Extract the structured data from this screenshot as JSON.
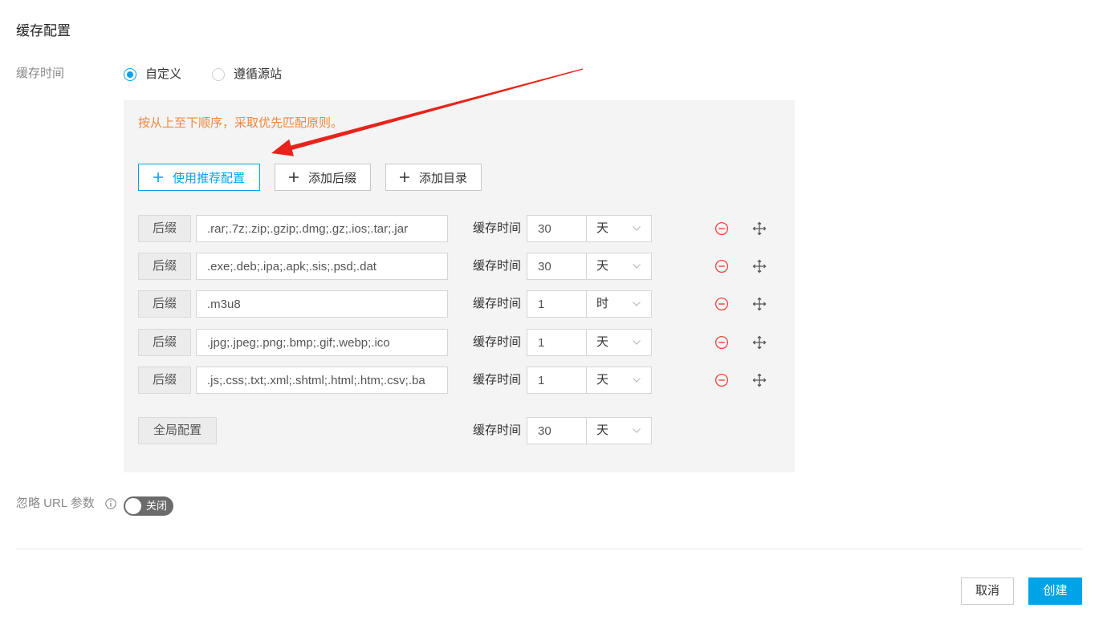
{
  "section": {
    "title": "缓存配置"
  },
  "cache_time": {
    "label": "缓存时间",
    "options": [
      {
        "label": "自定义",
        "selected": true
      },
      {
        "label": "遵循源站",
        "selected": false
      }
    ]
  },
  "rules_panel": {
    "hint": "按从上至下顺序，采取优先匹配原则。",
    "actions": {
      "use_recommended": "使用推荐配置",
      "add_suffix": "添加后缀",
      "add_directory": "添加目录"
    },
    "rows": [
      {
        "type": "后缀",
        "value": ".rar;.7z;.zip;.gzip;.dmg;.gz;.ios;.tar;.jar",
        "time_label": "缓存时间",
        "duration": "30",
        "unit": "天"
      },
      {
        "type": "后缀",
        "value": ".exe;.deb;.ipa;.apk;.sis;.psd;.dat",
        "time_label": "缓存时间",
        "duration": "30",
        "unit": "天"
      },
      {
        "type": "后缀",
        "value": ".m3u8",
        "time_label": "缓存时间",
        "duration": "1",
        "unit": "时"
      },
      {
        "type": "后缀",
        "value": ".jpg;.jpeg;.png;.bmp;.gif;.webp;.ico",
        "time_label": "缓存时间",
        "duration": "1",
        "unit": "天"
      },
      {
        "type": "后缀",
        "value": ".js;.css;.txt;.xml;.shtml;.html;.htm;.csv;.ba",
        "time_label": "缓存时间",
        "duration": "1",
        "unit": "天"
      }
    ],
    "global": {
      "label": "全局配置",
      "time_label": "缓存时间",
      "duration": "30",
      "unit": "天"
    }
  },
  "ignore_url_params": {
    "label": "忽略 URL 参数",
    "toggle_label": "关闭",
    "enabled": false
  },
  "footer": {
    "cancel_label": "取消",
    "create_label": "创建"
  },
  "icons": {
    "action_add": "plus-icon",
    "select_arrow": "chevron-down-icon",
    "remove_rule": "minus-circle-icon",
    "drag_rule": "move-icon",
    "info": "info-icon",
    "annotation": "annotation-arrow"
  },
  "colors": {
    "accent": "#00a3e6",
    "hint": "#f0883c",
    "danger": "#e5483f",
    "annotation": "#e8231b",
    "panel_bg": "#f4f4f4",
    "toggle_off": "#6b6b6b"
  }
}
